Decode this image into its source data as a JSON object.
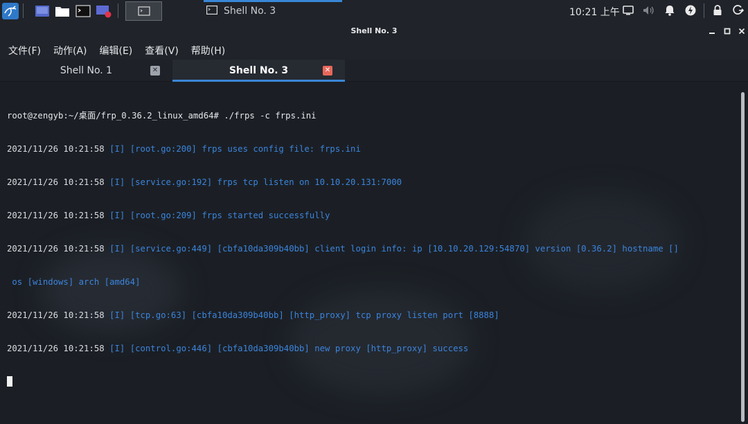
{
  "panel": {
    "launchers": [
      {
        "icon": "workspace-icon"
      },
      {
        "icon": "file-manager-icon"
      },
      {
        "icon": "terminal-launcher-icon"
      },
      {
        "icon": "screen-recorder-icon"
      }
    ],
    "task": {
      "label": "Shell No. 3",
      "icon": "terminal-icon"
    },
    "clock": "10:21 上午",
    "tray_icons": [
      "display-icon",
      "volume-icon",
      "notification-bell-icon",
      "power-manager-icon",
      "lock-icon",
      "logout-icon"
    ]
  },
  "window": {
    "title": "Shell No. 3"
  },
  "menu": [
    "文件(F)",
    "动作(A)",
    "编辑(E)",
    "查看(V)",
    "帮助(H)"
  ],
  "tabs": [
    {
      "label": "Shell No. 1",
      "active": false
    },
    {
      "label": "Shell No. 3",
      "active": true
    }
  ],
  "terminal": {
    "prompt_line": "root@zengyb:~/桌面/frp_0.36.2_linux_amd64# ./frps -c frps.ini",
    "log_lines": [
      {
        "ts": "2021/11/26 10:21:58",
        "msg": "[I] [root.go:200] frps uses config file: frps.ini"
      },
      {
        "ts": "2021/11/26 10:21:58",
        "msg": "[I] [service.go:192] frps tcp listen on 10.10.20.131:7000"
      },
      {
        "ts": "2021/11/26 10:21:58",
        "msg": "[I] [root.go:209] frps started successfully"
      },
      {
        "ts": "2021/11/26 10:21:58",
        "msg": "[I] [service.go:449] [cbfa10da309b40bb] client login info: ip [10.10.20.129:54870] version [0.36.2] hostname []"
      },
      {
        "ts": "",
        "msg": " os [windows] arch [amd64]"
      },
      {
        "ts": "2021/11/26 10:21:58",
        "msg": "[I] [tcp.go:63] [cbfa10da309b40bb] [http_proxy] tcp proxy listen port [8888]"
      },
      {
        "ts": "2021/11/26 10:21:58",
        "msg": "[I] [control.go:446] [cbfa10da309b40bb] new proxy [http_proxy] success"
      }
    ]
  },
  "colors": {
    "accent": "#3a86d6",
    "log_text": "#3b84dc",
    "close_active": "#e8675a"
  }
}
